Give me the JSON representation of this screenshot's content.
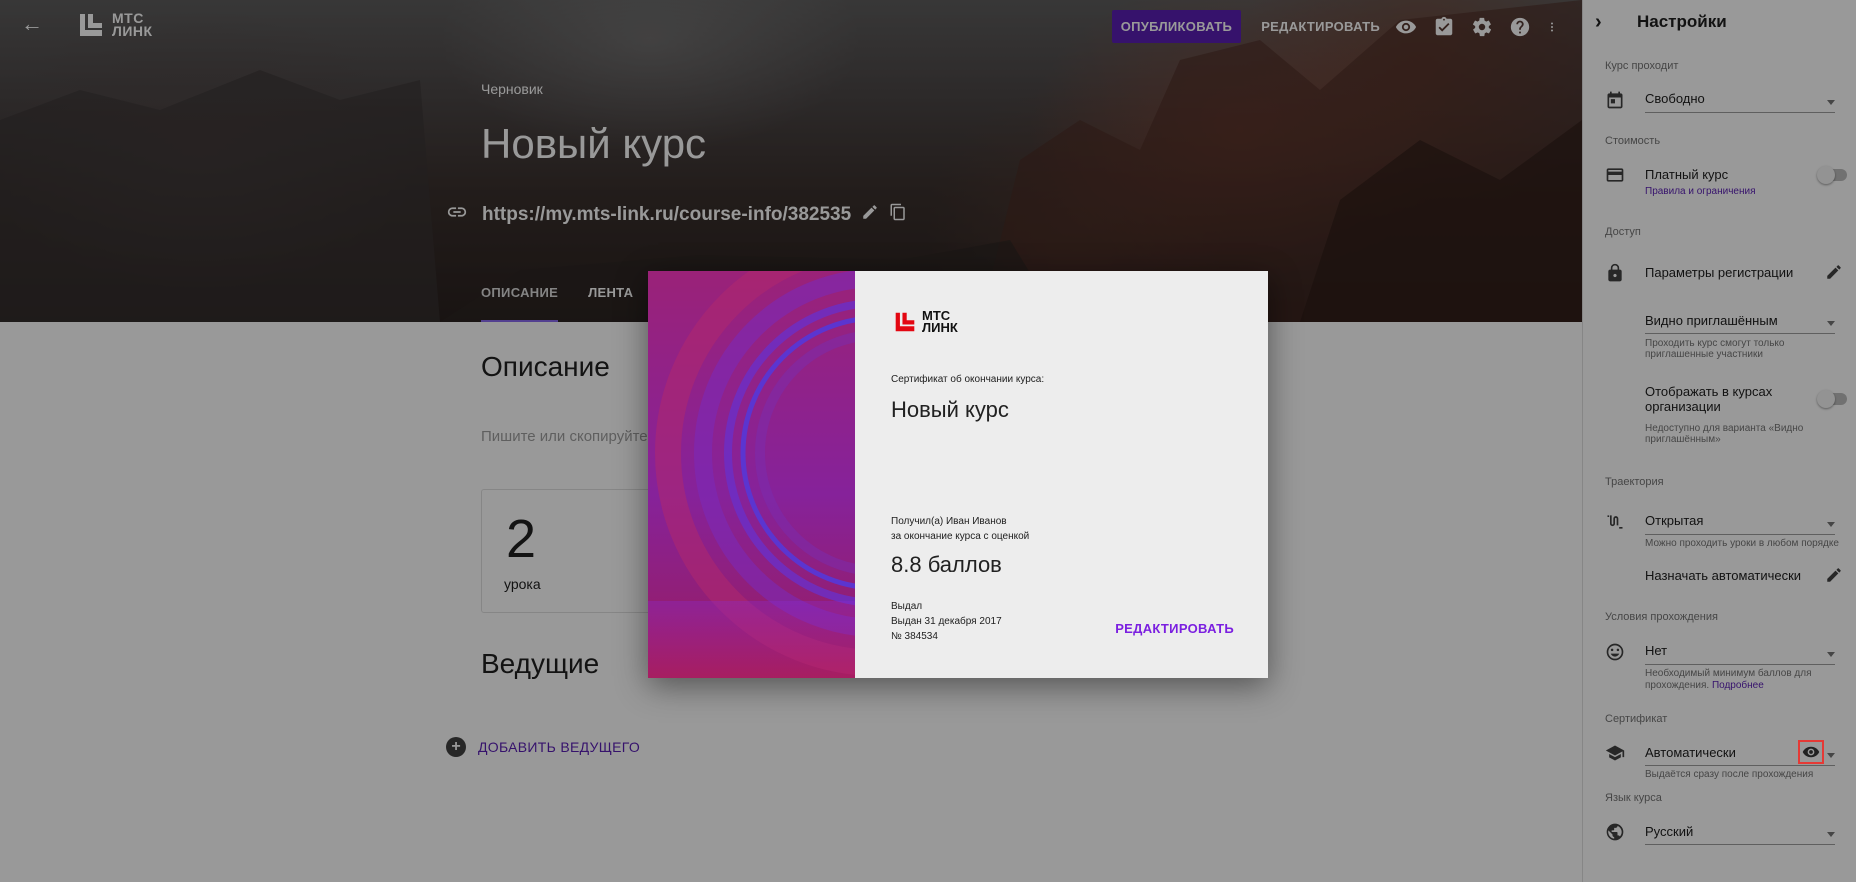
{
  "header": {
    "logo_line1": "МТС",
    "logo_line2": "ЛИНК",
    "publish_label": "ОПУБЛИКОВАТЬ",
    "edit_label": "РЕДАКТИРОВАТЬ",
    "icons": [
      "preview-eye-icon",
      "checklist-icon",
      "gear-icon",
      "help-icon",
      "more-vert-icon"
    ]
  },
  "course": {
    "status": "Черновик",
    "title": "Новый курс",
    "url": "https://my.mts-link.ru/course-info/382535"
  },
  "tabs": [
    {
      "label": "ОПИСАНИЕ",
      "active": true
    },
    {
      "label": "ЛЕНТА",
      "active": false
    }
  ],
  "main": {
    "description_heading": "Описание",
    "description_placeholder": "Пишите или скопируйте т",
    "lessons_count": "2",
    "lessons_label": "урока",
    "hosts_heading": "Ведущие",
    "add_host_label": "ДОБАВИТЬ ВЕДУЩЕГО"
  },
  "certificate": {
    "logo_line1": "МТС",
    "logo_line2": "ЛИНК",
    "caption": "Сертификат об окончании курса:",
    "course_name": "Новый курс",
    "received_line": "Получил(а) Иван Иванов",
    "for_line": "за окончание курса с оценкой",
    "score": "8.8 баллов",
    "issued_label": "Выдал",
    "issued_date": "Выдан 31 декабря 2017",
    "number": "№ 384534",
    "edit_label": "РЕДАКТИРОВАТЬ"
  },
  "sidebar": {
    "title": "Настройки",
    "course_pass_section": "Курс проходит",
    "course_pass_value": "Свободно",
    "cost_section": "Стоимость",
    "paid_label": "Платный курс",
    "paid_link": "Правила и ограничения",
    "access_section": "Доступ",
    "registration_label": "Параметры регистрации",
    "visibility_value": "Видно приглашённым",
    "visibility_hint1": "Проходить курс смогут только",
    "visibility_hint2": "приглашенные участники",
    "show_in_org_label1": "Отображать в курсах",
    "show_in_org_label2": "организации",
    "show_in_org_hint1": "Недоступно для варианта «Видно",
    "show_in_org_hint2": "приглашённым»",
    "trajectory_section": "Траектория",
    "trajectory_value": "Открытая",
    "trajectory_hint": "Можно проходить уроки в любом порядке",
    "auto_assign_label": "Назначать автоматически",
    "conditions_section": "Условия прохождения",
    "conditions_value": "Нет",
    "conditions_hint1": "Необходимый минимум баллов для",
    "conditions_hint2_text": "прохождения.",
    "conditions_hint2_link": "Подробнее",
    "certificate_section": "Сертификат",
    "certificate_value": "Автоматически",
    "certificate_hint": "Выдаётся сразу после прохождения",
    "language_section": "Язык курса",
    "language_value": "Русский"
  },
  "colors": {
    "accent": "#5a1fb5",
    "cert_edit": "#7b1fe0",
    "highlight_box": "#e53935"
  }
}
